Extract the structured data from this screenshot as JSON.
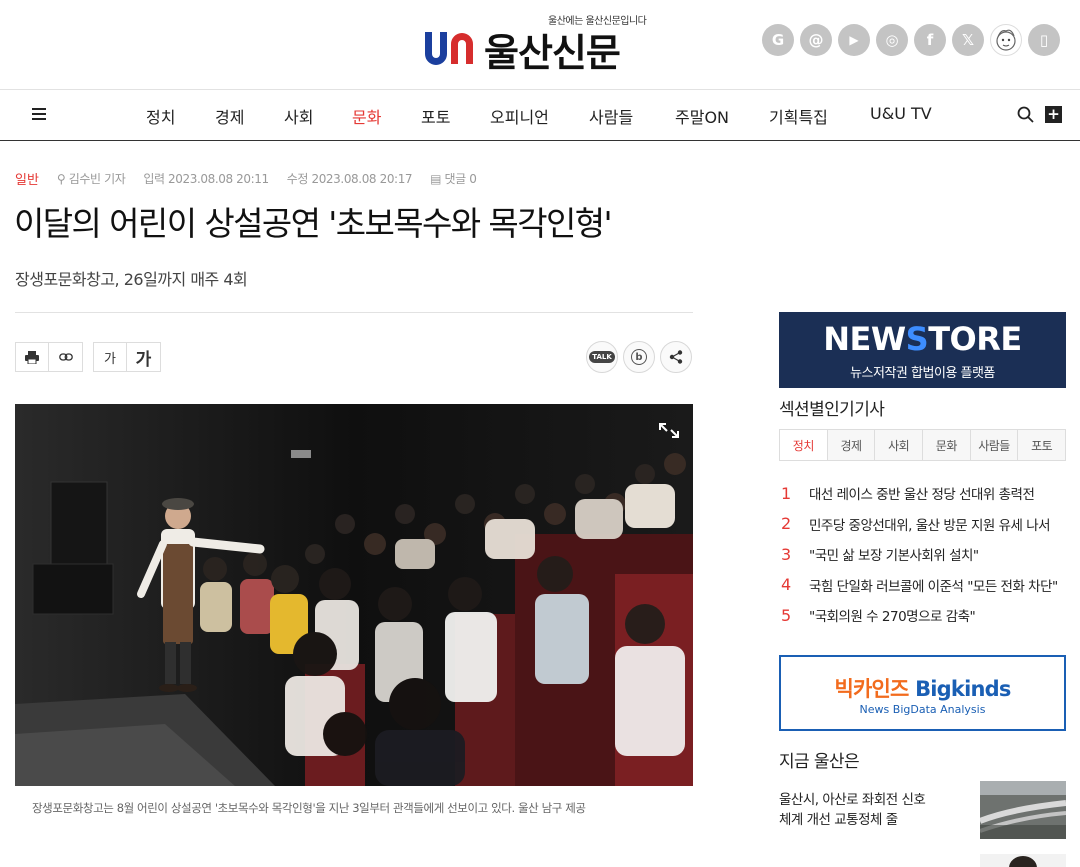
{
  "header": {
    "slogan": "울산에는 울산신문입니다",
    "logo_text": "울산신문",
    "social": [
      {
        "label": "G",
        "icon": "google-icon"
      },
      {
        "label": "@",
        "icon": "threads-icon"
      },
      {
        "label": "▶",
        "icon": "youtube-icon"
      },
      {
        "label": "◎",
        "icon": "instagram-icon"
      },
      {
        "label": "f",
        "icon": "facebook-icon"
      },
      {
        "label": "𝕏",
        "icon": "x-icon"
      },
      {
        "label": "",
        "icon": "mascot-icon"
      },
      {
        "label": "▯",
        "icon": "mobile-icon"
      }
    ]
  },
  "nav": {
    "items": [
      "정치",
      "경제",
      "사회",
      "문화",
      "포토",
      "오피니언",
      "사람들",
      "주말ON",
      "기획특집",
      "U&U TV"
    ],
    "active": "문화"
  },
  "article": {
    "category": "일반",
    "author": "김수빈 기자",
    "published": "입력 2023.08.08 20:11",
    "modified": "수정 2023.08.08 20:17",
    "comments": "댓글 0",
    "headline": "이달의 어린이 상설공연 '초보목수와 목각인형'",
    "subheadline": "장생포문화창고, 26일까지 매주 4회",
    "font_small": "가",
    "font_large": "가",
    "share_kakao": "TALK",
    "share_band": "b",
    "caption": "장생포문화창고는 8월 어린이 상설공연 '초보목수와 목각인형'을 지난 3일부터 관객들에게 선보이고 있다. 울산 남구 제공"
  },
  "sidebar": {
    "newstore": {
      "title_a": "NEW",
      "title_b": "S",
      "title_c": "TORE",
      "subtitle": "뉴스저작권 합법이용 플랫폼"
    },
    "popular_title": "섹션별인기기사",
    "tabs": [
      "정치",
      "경제",
      "사회",
      "문화",
      "사람들",
      "포토"
    ],
    "active_tab": "정치",
    "ranking": [
      {
        "num": "1",
        "text": "대선 레이스 중반 울산 정당 선대위 총력전"
      },
      {
        "num": "2",
        "text": "민주당 중앙선대위, 울산 방문 지원 유세 나서"
      },
      {
        "num": "3",
        "text": "\"국민 삶 보장 기본사회위 설치\""
      },
      {
        "num": "4",
        "text": "국힘 단일화 러브콜에 이준석 \"모든 전화 차단\""
      },
      {
        "num": "5",
        "text": "\"국회의원 수 270명으로 감축\""
      }
    ],
    "bigkinds": {
      "title_ko": "빅카인즈",
      "title_en": "Bigkinds",
      "subtitle": "News BigData Analysis"
    },
    "now_title": "지금 울산은",
    "now_item": "울산시, 아산로 좌회전 신호 체계 개선 교통정체 줄"
  },
  "colors": {
    "accent": "#e53935",
    "newstore_bg": "#1b2f55",
    "bigkinds_blue": "#1a5fb4",
    "bigkinds_orange": "#f26b1d"
  }
}
